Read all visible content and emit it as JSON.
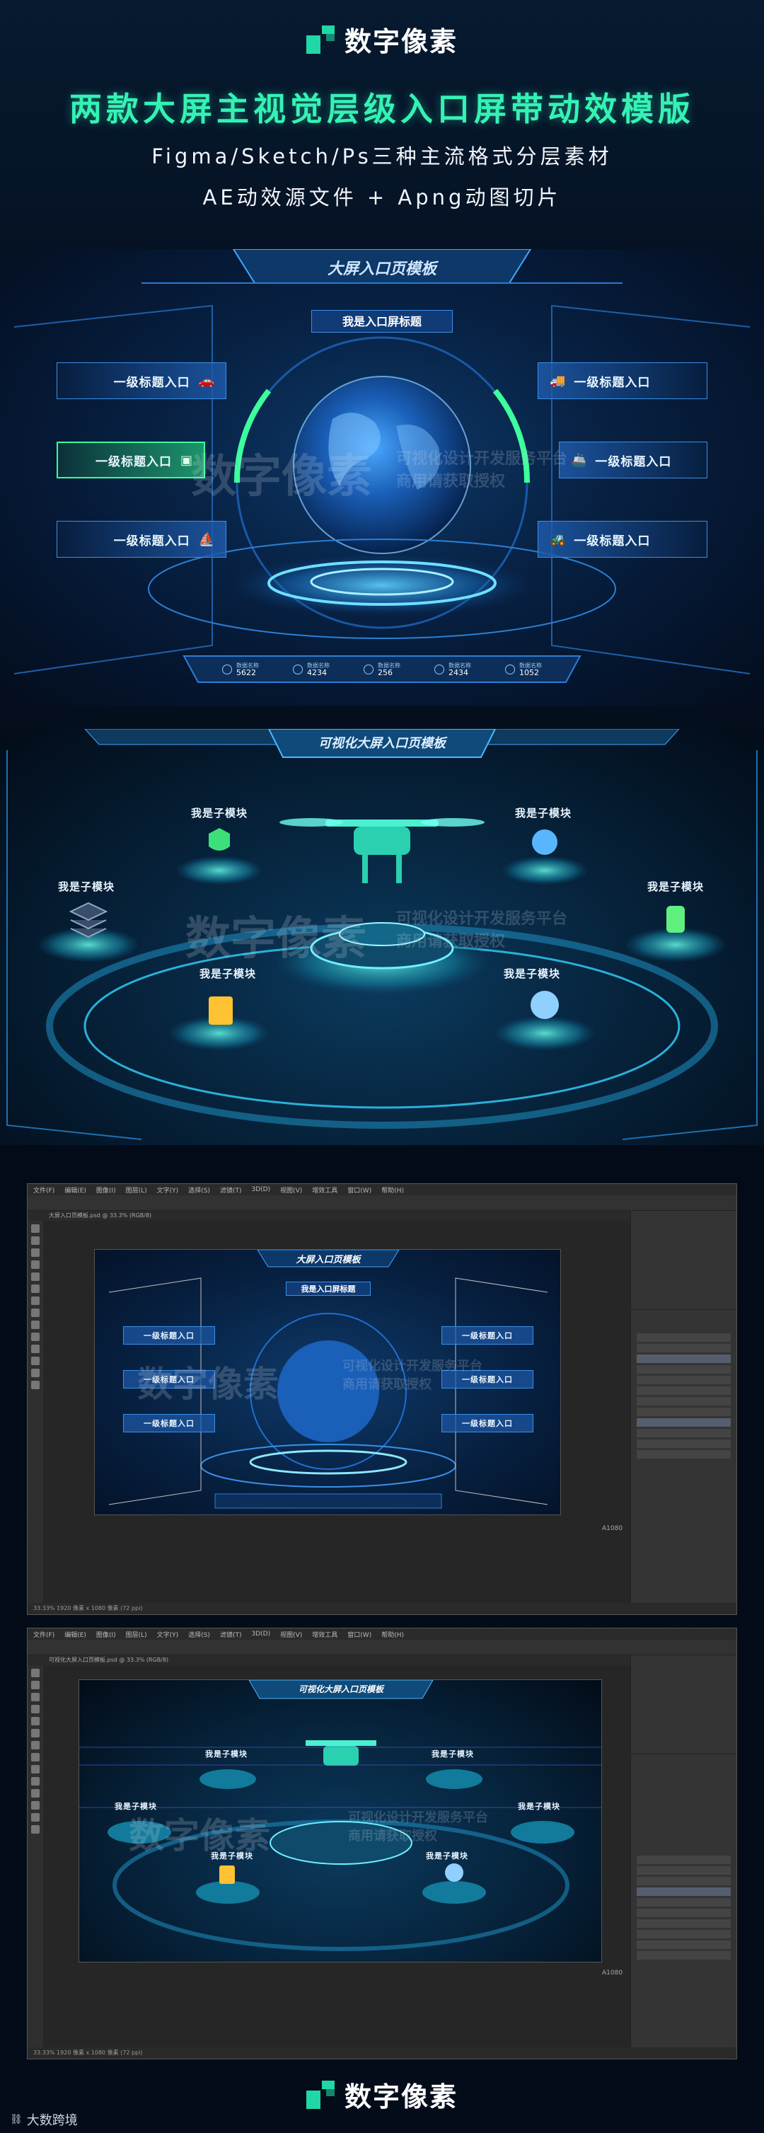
{
  "brand": {
    "name": "数字像素",
    "accent": "#20d7a6"
  },
  "header": {
    "title": "两款大屏主视觉层级入口屏带动效模版",
    "subtitle1": "Figma/Sketch/Ps三种主流格式分层素材",
    "subtitle2": "AE动效源文件 + Apng动图切片"
  },
  "screen1": {
    "banner": "大屏入口页模板",
    "subtitle": "我是入口屏标题",
    "entries_left": [
      "一级标题入口",
      "一级标题入口",
      "一级标题入口"
    ],
    "entries_right": [
      "一级标题入口",
      "一级标题入口",
      "一级标题入口"
    ],
    "icons_left": [
      "car-icon",
      "screen-icon",
      "sail-icon"
    ],
    "icons_right": [
      "truck-icon",
      "ship-icon",
      "forklift-icon"
    ],
    "stats": [
      {
        "label": "数据名称",
        "value": "5622"
      },
      {
        "label": "数据名称",
        "value": "4234"
      },
      {
        "label": "数据名称",
        "value": "256"
      },
      {
        "label": "数据名称",
        "value": "2434"
      },
      {
        "label": "数据名称",
        "value": "1052"
      }
    ]
  },
  "screen2": {
    "banner": "可视化大屏入口页模板",
    "modules": [
      "我是子模块",
      "我是子模块",
      "我是子模块",
      "我是子模块",
      "我是子模块",
      "我是子模块"
    ]
  },
  "watermark": {
    "big": "数字像素",
    "line1": "可视化设计开发服务平台",
    "line2": "商用请获取授权"
  },
  "ps1": {
    "menus": [
      "文件(F)",
      "编辑(E)",
      "图像(I)",
      "图层(L)",
      "文字(Y)",
      "选择(S)",
      "滤镜(T)",
      "3D(D)",
      "视图(V)",
      "增效工具",
      "窗口(W)",
      "帮助(H)"
    ],
    "tab": "大屏入口页模板.psd @ 33.3% (RGB/8)",
    "status": "33.33%  1920 像素 x 1080 像素 (72 ppi)",
    "corner": "A1080",
    "banner": "大屏入口页模板",
    "subtitle": "我是入口屏标题",
    "entries": [
      "一级标题入口",
      "一级标题入口",
      "一级标题入口",
      "一级标题入口",
      "一级标题入口",
      "一级标题入口"
    ]
  },
  "ps2": {
    "menus": [
      "文件(F)",
      "编辑(E)",
      "图像(I)",
      "图层(L)",
      "文字(Y)",
      "选择(S)",
      "滤镜(T)",
      "3D(D)",
      "视图(V)",
      "增效工具",
      "窗口(W)",
      "帮助(H)"
    ],
    "tab": "可视化大屏入口页模板.psd @ 33.3% (RGB/8)",
    "status": "33.33%  1920 像素 x 1080 像素 (72 ppi)",
    "corner": "A1080",
    "banner": "可视化大屏入口页模板",
    "modules": [
      "我是子模块",
      "我是子模块",
      "我是子模块",
      "我是子模块",
      "我是子模块",
      "我是子模块"
    ]
  },
  "footer": {
    "logo_text": "大数跨境"
  }
}
